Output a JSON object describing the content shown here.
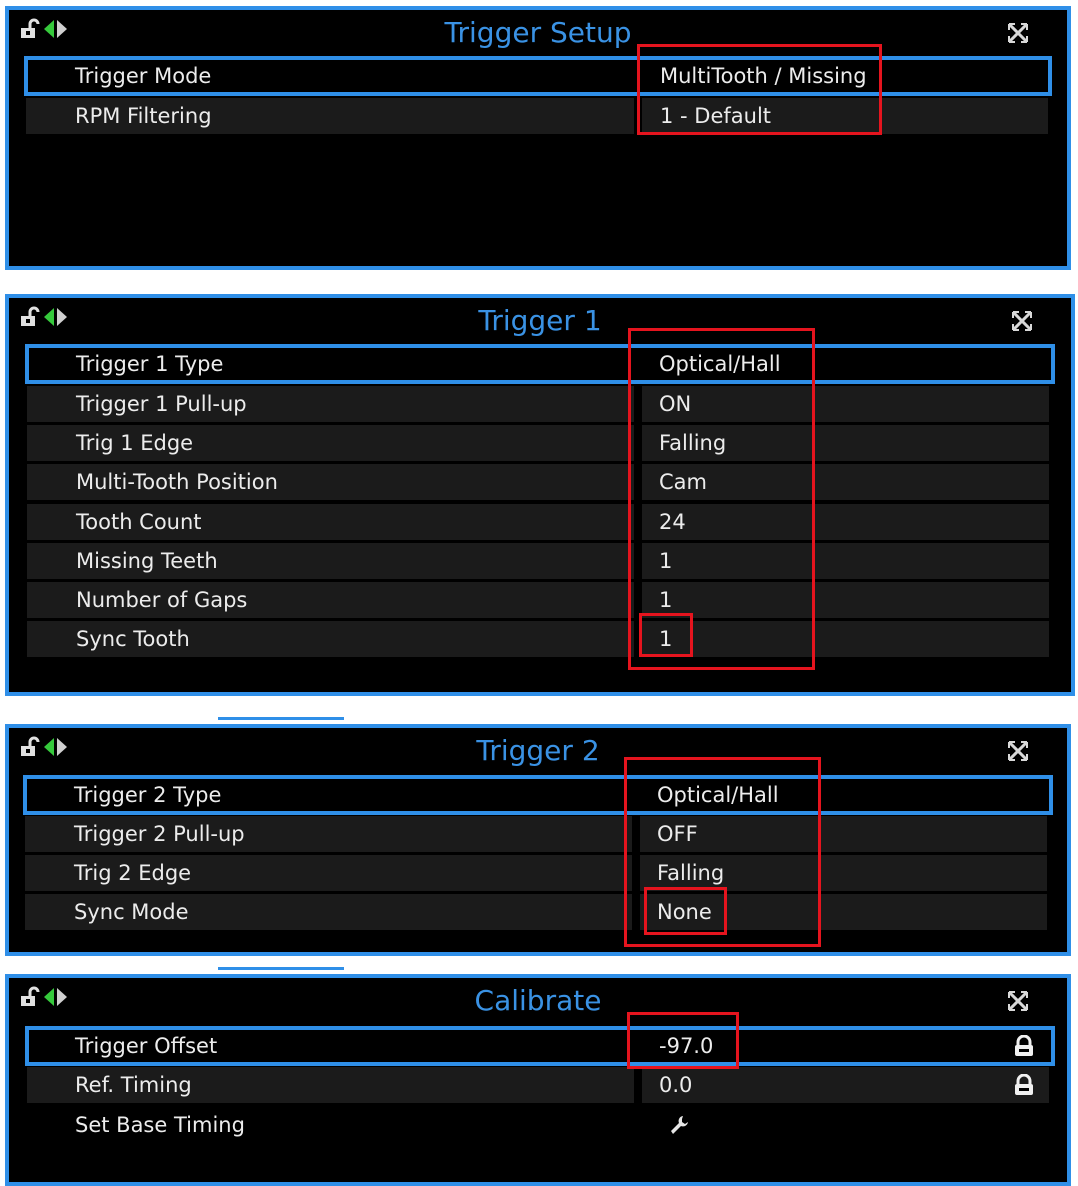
{
  "panels": [
    {
      "title": "Trigger Setup",
      "rows": [
        {
          "name": "Trigger Mode",
          "value": "MultiTooth / Missing"
        },
        {
          "name": "RPM Filtering",
          "value": "1 - Default"
        }
      ]
    },
    {
      "title": "Trigger 1",
      "rows": [
        {
          "name": "Trigger 1 Type",
          "value": "Optical/Hall"
        },
        {
          "name": "Trigger 1 Pull-up",
          "value": "ON"
        },
        {
          "name": "Trig 1 Edge",
          "value": "Falling"
        },
        {
          "name": "Multi-Tooth Position",
          "value": "Cam"
        },
        {
          "name": "Tooth Count",
          "value": "24"
        },
        {
          "name": "Missing Teeth",
          "value": "1"
        },
        {
          "name": "Number of Gaps",
          "value": "1"
        },
        {
          "name": "Sync Tooth",
          "value": "1"
        }
      ]
    },
    {
      "title": "Trigger 2",
      "rows": [
        {
          "name": "Trigger 2 Type",
          "value": "Optical/Hall"
        },
        {
          "name": "Trigger 2 Pull-up",
          "value": "OFF"
        },
        {
          "name": "Trig 2 Edge",
          "value": "Falling"
        },
        {
          "name": "Sync Mode",
          "value": "None"
        }
      ]
    },
    {
      "title": "Calibrate",
      "rows": [
        {
          "name": "Trigger Offset",
          "value": "-97.0",
          "icon": "lock-icon"
        },
        {
          "name": "Ref. Timing",
          "value": "0.0",
          "icon": "lock-icon"
        },
        {
          "name": "Set Base Timing",
          "value": "",
          "icon": "wrench-icon"
        }
      ]
    }
  ],
  "colors": {
    "panel_border": "#2f8fe8",
    "title_text": "#3a92e4",
    "annotation_box": "#e5141e",
    "row_bg": "#1b1b1b",
    "nav_left_arrow": "#36c93c"
  }
}
